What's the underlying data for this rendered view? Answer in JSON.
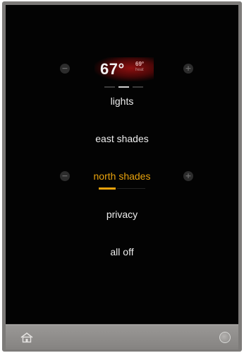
{
  "thermostat": {
    "current_temp": "67°",
    "target_temp": "69°",
    "mode": "heat",
    "decrease_symbol": "−",
    "increase_symbol": "+"
  },
  "menu": {
    "items": [
      {
        "label": "lights",
        "selected": false
      },
      {
        "label": "east shades",
        "selected": false
      },
      {
        "label": "north shades",
        "selected": true
      },
      {
        "label": "privacy",
        "selected": false
      },
      {
        "label": "all off",
        "selected": false
      }
    ],
    "decrease_symbol": "−",
    "increase_symbol": "+"
  },
  "colors": {
    "accent": "#e8a20c",
    "screen_background": "#030303",
    "frame": "#7d7b79",
    "temp_glow": "#8e1010"
  },
  "icons": {
    "home": "home-icon",
    "power": "power-icon"
  }
}
